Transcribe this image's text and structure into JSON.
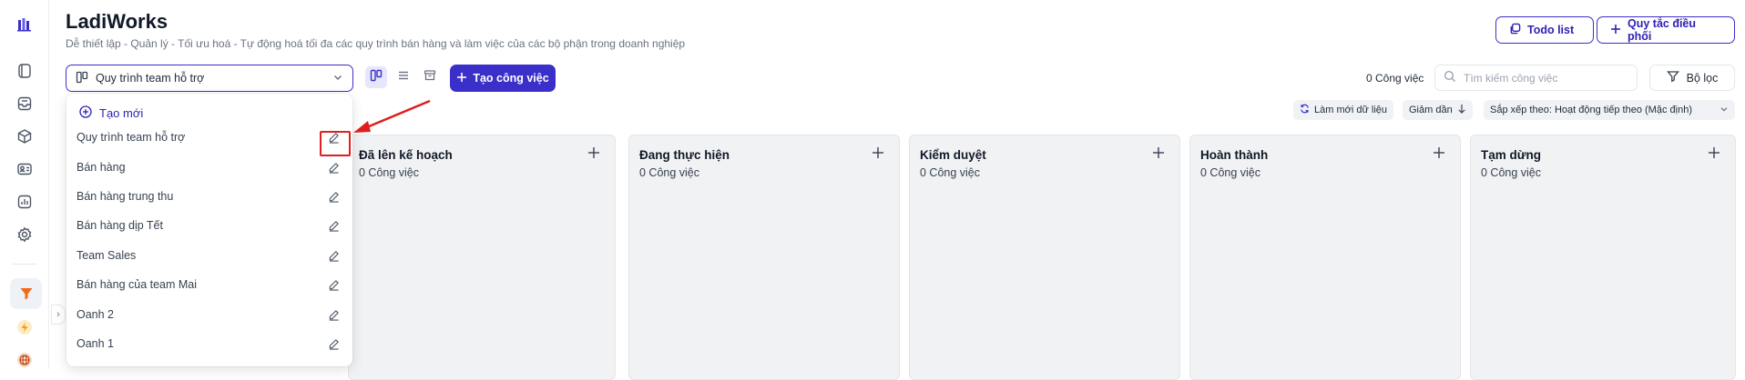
{
  "app": {
    "title": "LadiWorks",
    "subtitle": "Dễ thiết lập - Quản lý - Tối ưu hoá - Tự động hoá tối đa các quy trình bán hàng và làm việc của các bộ phận trong doanh nghiệp"
  },
  "header_buttons": {
    "todo_label": "Todo list",
    "rules_label": "Quy tắc điều phối"
  },
  "toolbar": {
    "pipeline_selected": "Quy trình team hỗ trợ",
    "create_task_label": "Tạo công việc",
    "task_count": "0 Công việc",
    "search_placeholder": "Tìm kiếm công việc",
    "filter_label": "Bộ lọc"
  },
  "chips": {
    "refresh_label": "Làm mới dữ liệu",
    "sort_dir_label": "Giảm dần",
    "sort_by_label": "Sắp xếp theo: Hoạt động tiếp theo (Mặc định)"
  },
  "columns": [
    {
      "title": "Đã lên kế hoạch",
      "count": "0 Công việc"
    },
    {
      "title": "Đang thực hiện",
      "count": "0 Công việc"
    },
    {
      "title": "Kiểm duyệt",
      "count": "0 Công việc"
    },
    {
      "title": "Hoàn thành",
      "count": "0 Công việc"
    },
    {
      "title": "Tạm dừng",
      "count": "0 Công việc"
    }
  ],
  "dropdown": {
    "create_label": "Tạo mới",
    "items": [
      "Quy trình team hỗ trợ",
      "Bán hàng",
      "Bán hàng trung thu",
      "Bán hàng dịp Tết",
      "Team Sales",
      "Bán hàng của team Mai",
      "Oanh 2",
      "Oanh 1"
    ]
  },
  "colors": {
    "accent": "#3b2fc9",
    "annotation_red": "#e11d1d",
    "column_bg": "#f1f2f4",
    "sidebar_active_bg": "#eef1f6"
  },
  "icons": {
    "sidebar": [
      "logo-icon",
      "book-icon",
      "inbox-icon",
      "box-icon",
      "contact-icon",
      "chart-icon",
      "gear-icon",
      "funnel-icon",
      "lightning-icon",
      "globe-icon"
    ]
  }
}
